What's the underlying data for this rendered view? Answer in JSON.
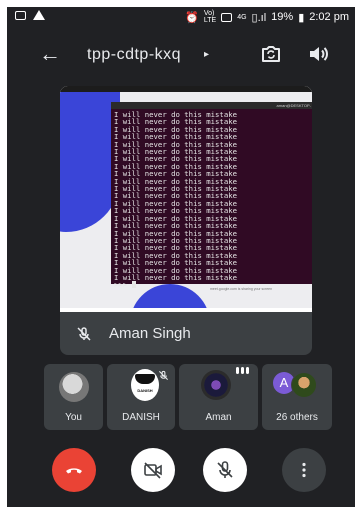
{
  "status_bar": {
    "volte_label": "Vo)\nLTE",
    "network_label": "4G",
    "battery": "19%",
    "time": "2:02 pm"
  },
  "header": {
    "meeting_code": "tpp-cdtp-kxq",
    "caret": "▸"
  },
  "presentation": {
    "presenter_name": "Aman Singh",
    "terminal_title": "aman@DESKTOP-",
    "terminal_lines": [
      "I will never do this mistake",
      "I will never do this mistake",
      "I will never do this mistake",
      "I will never do this mistake",
      "I will never do this mistake",
      "I will never do this mistake",
      "I will never do this mistake",
      "I will never do this mistake",
      "I will never do this mistake",
      "I will never do this mistake",
      "I will never do this mistake",
      "I will never do this mistake",
      "I will never do this mistake",
      "I will never do this mistake",
      "I will never do this mistake",
      "I will never do this mistake",
      "I will never do this mistake",
      "I will never do this mistake",
      "I will never do this mistake",
      "I will never do this mistake",
      "I will never do this mistake",
      "I will never do this mistake",
      "I will never do this mistake"
    ],
    "prompt": ">>> ",
    "share_footer": "meet.google.com is sharing your screen"
  },
  "participants": [
    {
      "label": "You"
    },
    {
      "label": "DANISH",
      "avatar_text": "DANISH"
    },
    {
      "label": "Aman"
    },
    {
      "label": "26 others",
      "initial": "A"
    }
  ],
  "controls": {
    "end_call_color": "#ea4335",
    "accent_white": "#ffffff"
  }
}
